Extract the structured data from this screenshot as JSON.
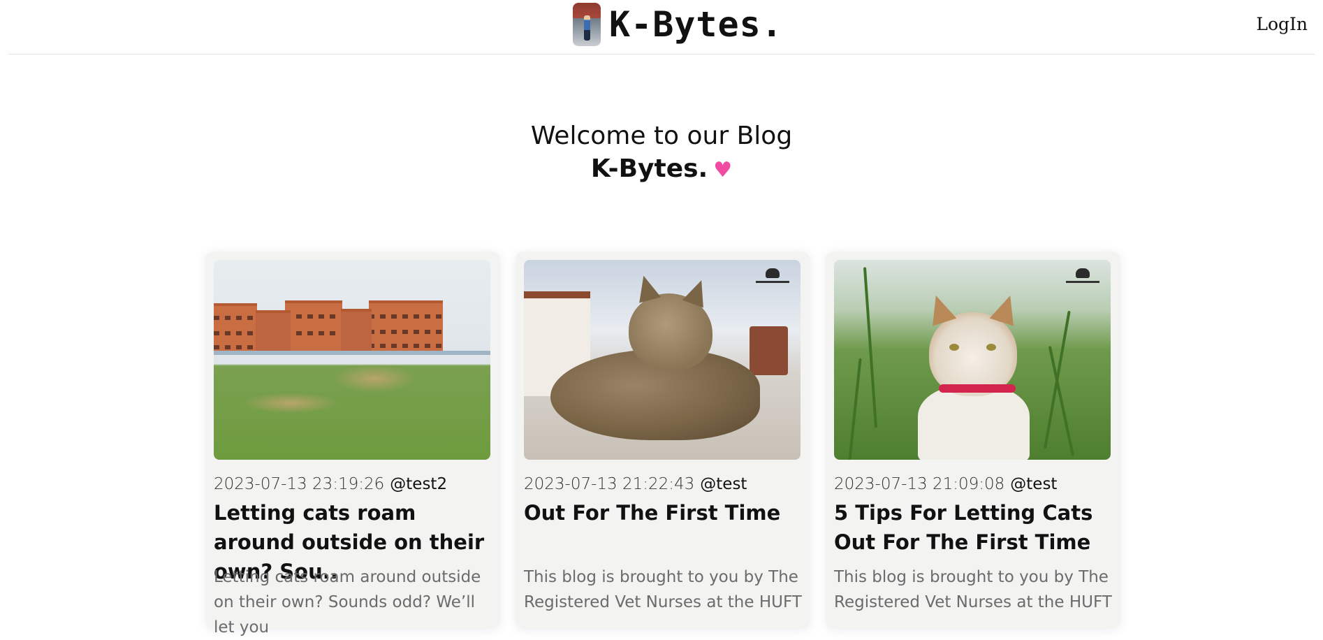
{
  "header": {
    "brand": "K-Bytes.",
    "login_label": "LogIn"
  },
  "hero": {
    "welcome": "Welcome to our Blog",
    "blog_name": "K-Bytes.",
    "heart": "♥",
    "heart_color": "#f14aa2"
  },
  "posts": [
    {
      "date": "2023-07-13 23:19:26",
      "author": "@test2",
      "title": "Letting cats roam around outside on their own? Sou..",
      "excerpt": "Letting cats roam around outside on their own? Sounds odd? We’ll let you",
      "image": "school-building-image"
    },
    {
      "date": "2023-07-13 21:22:43",
      "author": "@test",
      "title": "Out For The First Time",
      "excerpt": "This blog is brought to you by The Registered Vet Nurses at the HUFT",
      "image": "tabby-cat-image"
    },
    {
      "date": "2023-07-13 21:09:08",
      "author": "@test",
      "title": "5 Tips For Letting Cats Out For The First Time",
      "excerpt": "This blog is brought to you by The Registered Vet Nurses at the HUFT",
      "image": "cat-in-grass-image"
    }
  ]
}
